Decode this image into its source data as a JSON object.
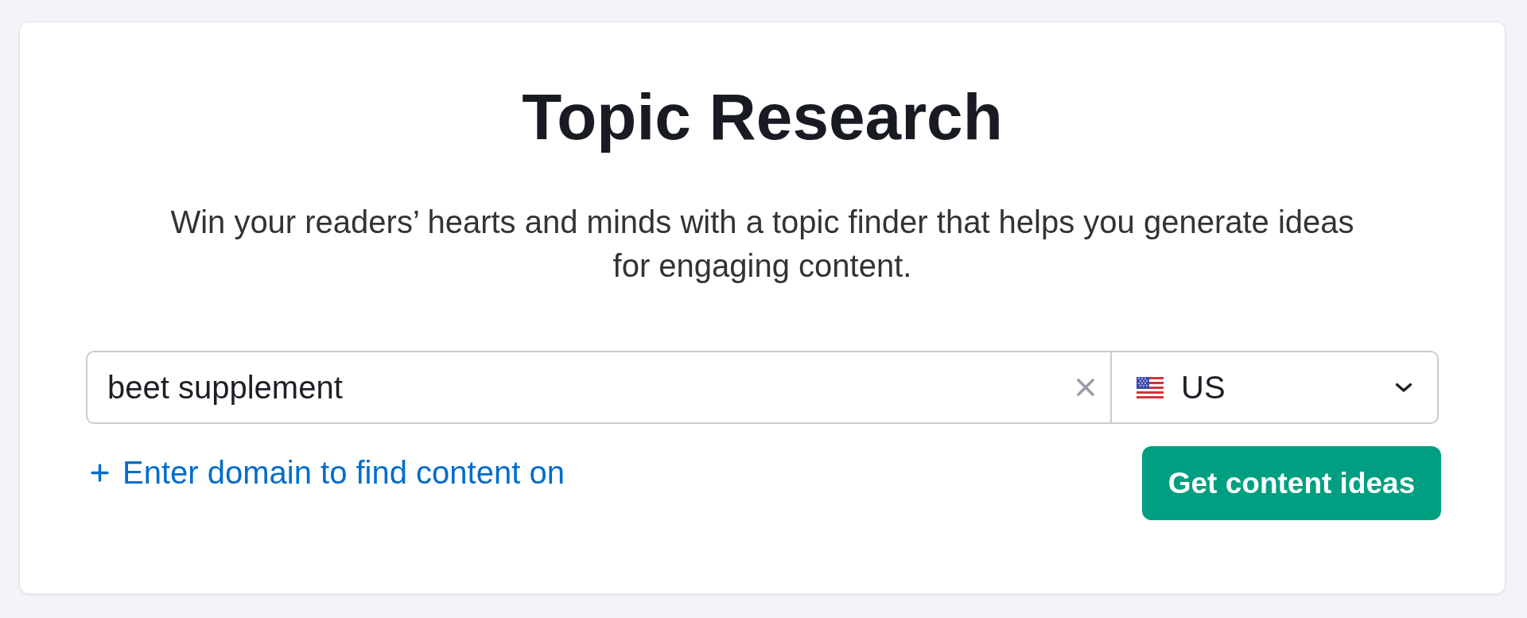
{
  "title": "Topic Research",
  "subtitle": "Win your readers’ hearts and minds with a topic finder that helps you generate ideas for engaging content.",
  "search": {
    "value": "beet supplement"
  },
  "database": {
    "value": "US"
  },
  "domain_link": {
    "label": "Enter domain to find content on"
  },
  "buttons": [
    {
      "label": "Get content ideas",
      "kind": "primary"
    }
  ]
}
